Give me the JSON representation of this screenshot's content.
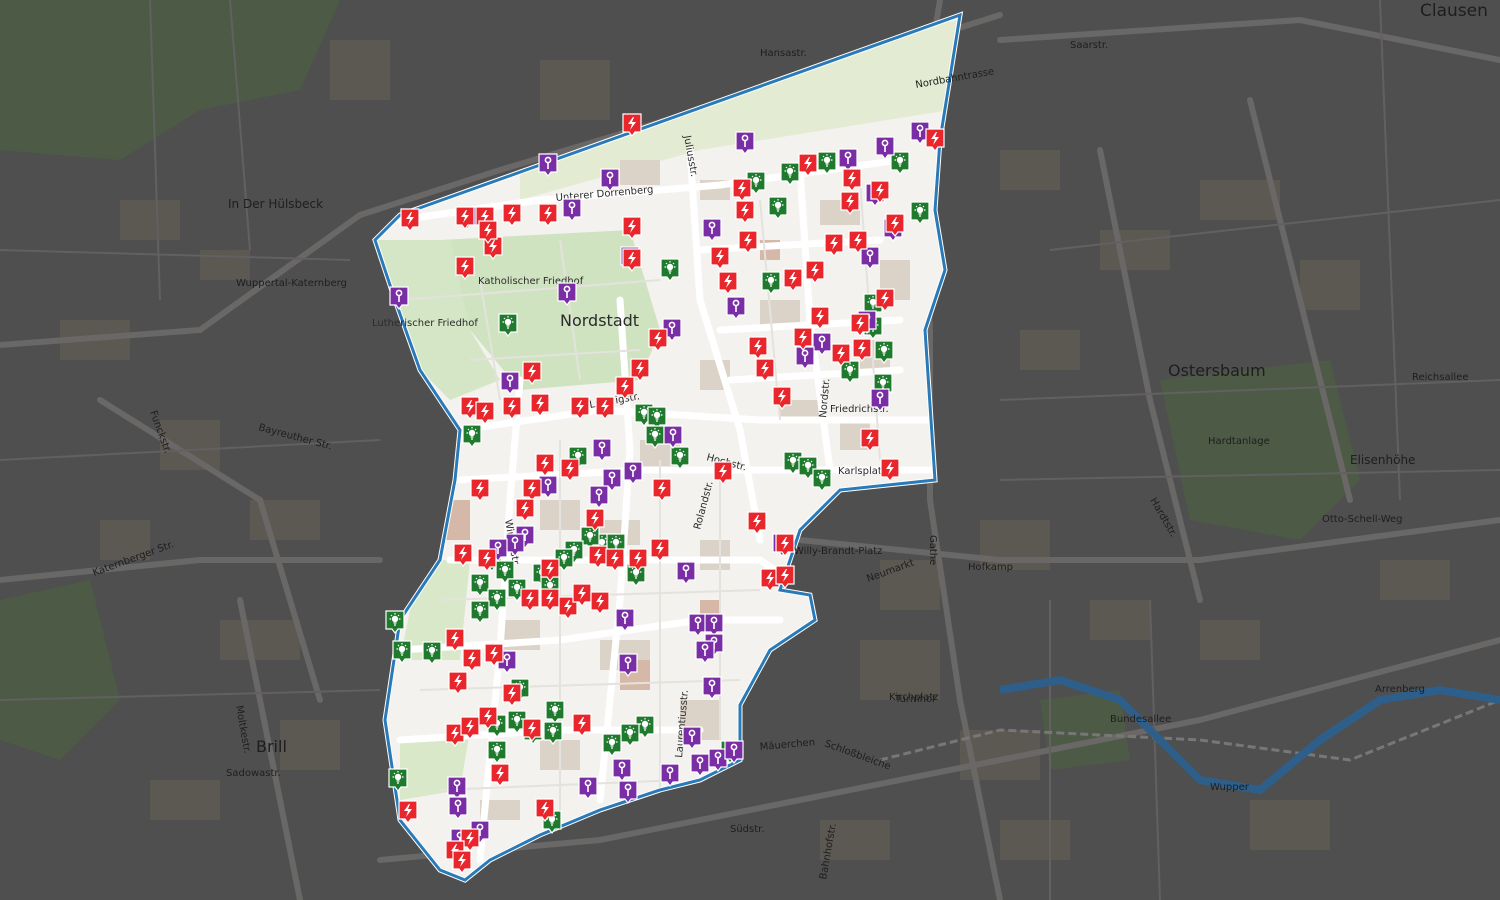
{
  "map": {
    "district_label": "Nordstadt",
    "colors": {
      "red": "#e8262b",
      "purple": "#7a2ea5",
      "green": "#1f7a2e",
      "boundary": "#2a7ab8",
      "outside_tint": "#5a5a5a"
    },
    "place_labels": [
      {
        "text": "Clausen",
        "size": "l"
      },
      {
        "text": "Ostersbaum",
        "size": "l"
      },
      {
        "text": "Brill",
        "size": "l"
      },
      {
        "text": "Nordstadt",
        "size": "l"
      },
      {
        "text": "Elisenhöhe",
        "size": "m"
      },
      {
        "text": "In Der Hülsbeck",
        "size": "m"
      },
      {
        "text": "Wuppertal-Katernberg",
        "size": "s"
      },
      {
        "text": "Katholischer Friedhof",
        "size": "s"
      },
      {
        "text": "Lutherischer Friedhof",
        "size": "s"
      },
      {
        "text": "Hardtanlage",
        "size": "s"
      }
    ],
    "street_labels": [
      "Hansastr.",
      "Saarstr.",
      "Hochstr.",
      "Bundesallee",
      "Neumarkt",
      "Friedrichstr.",
      "Ludwigstr.",
      "Sadowastr.",
      "Bahnhofstr.",
      "Gathe",
      "Karlsplatz",
      "Schloßbleiche",
      "Turmhof",
      "Hofkamp",
      "Willy-Brandt-Platz",
      "Nordbahntrasse",
      "Unterer Dorrenberg",
      "Juliusstr.",
      "Nordstr.",
      "Reichsallee",
      "Otto-Schell-Weg",
      "Katernberger Str.",
      "Kirchplatz",
      "Mäuerchen",
      "Südstr.",
      "Hardtstr.",
      "Bayreuther Str.",
      "Funckstr.",
      "Moltkestr.",
      "Arrenberg",
      "Wupper",
      "Laurentiusstr.",
      "Rolandstr.",
      "Wirkerstr."
    ],
    "markers": {
      "red_positions_count_note": "",
      "legend": []
    }
  }
}
